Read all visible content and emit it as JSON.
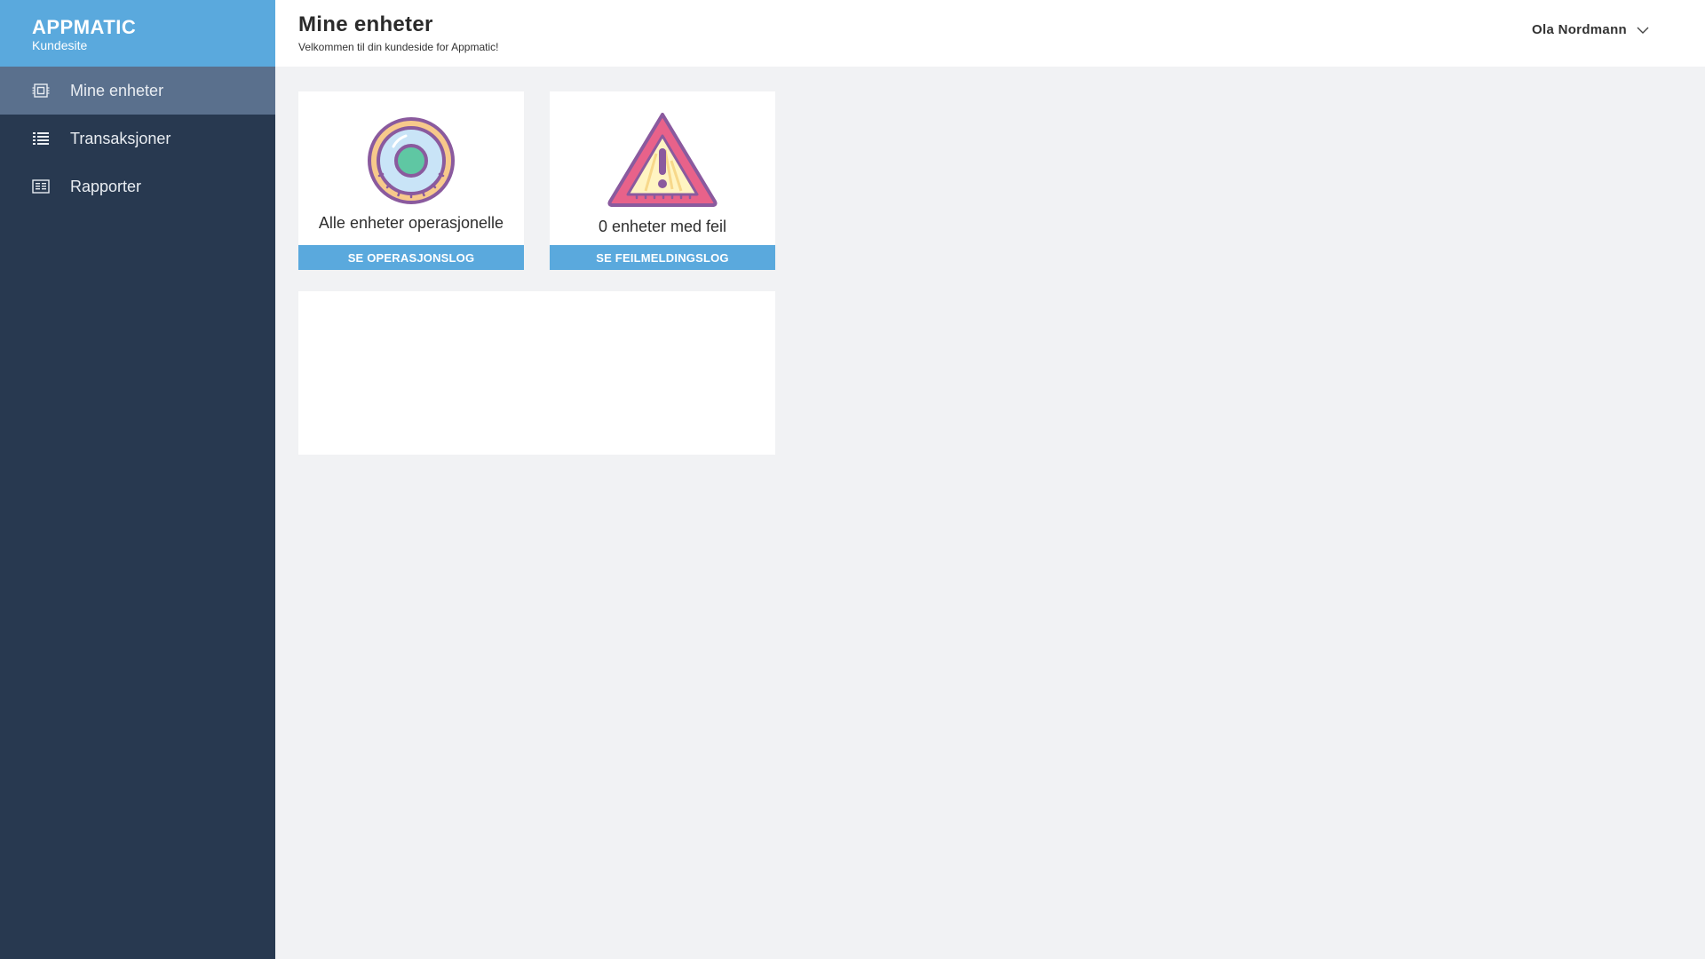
{
  "brand": {
    "title": "APPMATIC",
    "subtitle": "Kundesite",
    "color": "#5aa9dd"
  },
  "sidebar": {
    "items": [
      {
        "label": "Mine enheter",
        "icon": "chip-icon",
        "active": true
      },
      {
        "label": "Transaksjoner",
        "icon": "list-icon",
        "active": false
      },
      {
        "label": "Rapporter",
        "icon": "report-icon",
        "active": false
      }
    ]
  },
  "header": {
    "title": "Mine enheter",
    "subtitle": "Velkommen til din kundeside for Appmatic!",
    "user": "Ola Nordmann"
  },
  "cards": [
    {
      "text": "Alle enheter operasjonelle",
      "button": "SE OPERASJONSLOG",
      "icon": "status-ok-icon"
    },
    {
      "text": "0 enheter med feil",
      "button": "SE FEILMELDINGSLOG",
      "icon": "warning-icon"
    }
  ]
}
